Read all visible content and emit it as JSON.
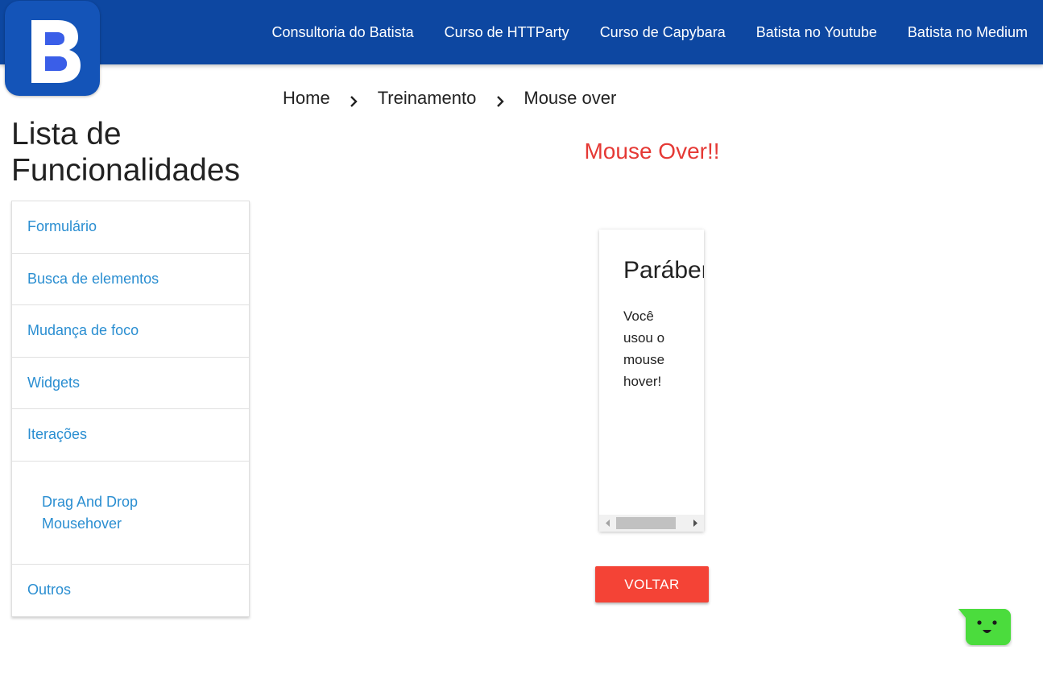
{
  "logo": {
    "letter": "B"
  },
  "nav": {
    "links": [
      "Consultoria do Batista",
      "Curso de HTTParty",
      "Curso de Capybara",
      "Batista no Youtube",
      "Batista no Medium"
    ]
  },
  "sidebar": {
    "title_line1": "Lista de",
    "title_line2": "Funcionalidades",
    "items": [
      "Formulário",
      "Busca de elementos",
      "Mudança de foco",
      "Widgets",
      "Iterações"
    ],
    "subitems": [
      "Drag And Drop",
      "Mousehover"
    ],
    "last_item": "Outros"
  },
  "breadcrumb": {
    "items": [
      "Home",
      "Treinamento",
      "Mouse over"
    ]
  },
  "main": {
    "title": "Mouse Over!!",
    "card_title": "Parábens",
    "card_text": "Você usou o mouse hover!",
    "back_button": "VOLTAR"
  },
  "colors": {
    "navbar": "#0d47a1",
    "link": "#2a8ed1",
    "title_red": "#e53935",
    "button_red": "#f44336",
    "chat_green": "#4cdc3c"
  },
  "icons": [
    "chevron-right-icon",
    "scroll-left-arrow-icon",
    "scroll-right-arrow-icon",
    "chat-bot-icon"
  ]
}
